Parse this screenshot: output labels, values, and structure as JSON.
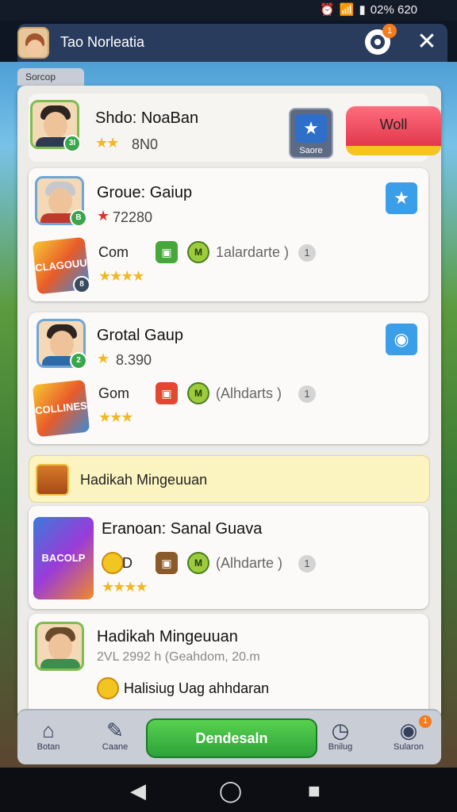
{
  "status": {
    "time": "02% 620",
    "icons": [
      "alarm-icon",
      "wifi-icon",
      "signal-icon",
      "battery-icon"
    ]
  },
  "header": {
    "title": "Tao Norleatia",
    "notif_badge": "1"
  },
  "panel": {
    "tab_label": "Sorcop"
  },
  "top_player": {
    "name": "Shdo: NoaBan",
    "score": "8N0",
    "level": "3I",
    "star_button_label": "Saore",
    "action_label": "Woll"
  },
  "groups": [
    {
      "name": "Groue: Gaiup",
      "score": "72280",
      "level": "B",
      "gem_label": "Com",
      "coin": "M",
      "link_text": "1alardarte )",
      "count": "1",
      "badge_text": "CLAGOUU",
      "badge_level": "8"
    },
    {
      "name": "Grotal Gaup",
      "score": "8.390",
      "level": "2",
      "gem_label": "Gom",
      "coin": "M",
      "link_text": "(Alhdarts )",
      "count": "1",
      "badge_text": "COLLINES",
      "badge_level": ""
    }
  ],
  "notice": {
    "text": "Hadikah Mingeuuan"
  },
  "event": {
    "name": "Eranoan: Sanal Guava",
    "gem_label": "D",
    "coin": "M",
    "link_text": "(Alhdarte )",
    "count": "1",
    "badge_text": "BACOLP"
  },
  "reward": {
    "title": "Hadikah Mingeuuan",
    "subtitle": "2VL 2992 h (Geahdom, 20.m",
    "line": "Halisiug Uag ahhdaran"
  },
  "nav": {
    "items": [
      {
        "label": "Botan",
        "icon": "home-icon"
      },
      {
        "label": "Caane",
        "icon": "edit-icon"
      },
      {
        "label": "Bnilug",
        "icon": "clock-icon"
      },
      {
        "label": "Sularon",
        "icon": "profile-icon",
        "badge": "1"
      }
    ],
    "primary_label": "Dendesaln"
  },
  "colors": {
    "header": "#2a3c5e",
    "primary": "#3ab544",
    "accent_red": "#e2384d",
    "notice": "#fbf3c0"
  }
}
